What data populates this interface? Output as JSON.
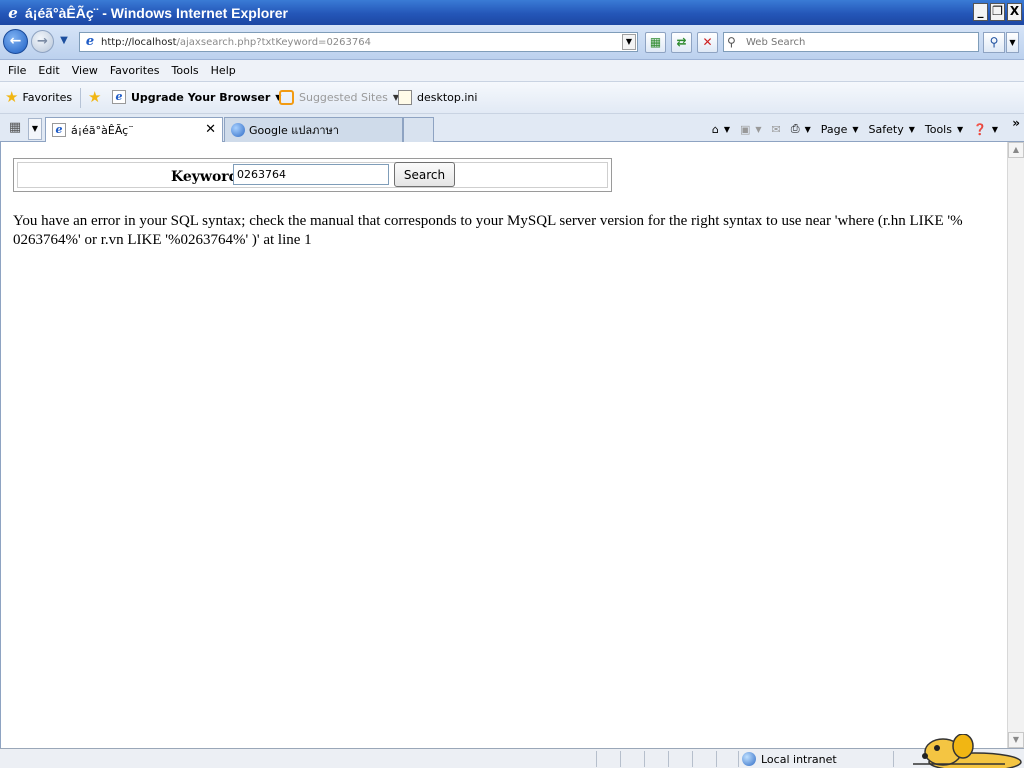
{
  "window": {
    "title": "á¡éã°àÊÃç¨ - Windows Internet Explorer",
    "controls": {
      "minimize": "_",
      "restore": "❐",
      "close": "X"
    }
  },
  "navigation": {
    "url_host": "http://localhost",
    "url_path": "/ajaxsearch.php?txtKeyword=0263764",
    "search_placeholder": "Web Search"
  },
  "menu": [
    "File",
    "Edit",
    "View",
    "Favorites",
    "Tools",
    "Help"
  ],
  "favorites_bar": {
    "favorites_label": "Favorites",
    "items": [
      "Upgrade Your Browser",
      "Suggested Sites",
      "desktop.ini"
    ]
  },
  "tabs": [
    {
      "label": "á¡éã°àÊÃç¨",
      "active": true
    },
    {
      "label": "Google แปลภาษา",
      "active": false
    }
  ],
  "command_bar": [
    "Page",
    "Safety",
    "Tools"
  ],
  "form": {
    "label": "Keyword",
    "value": "0263764",
    "button": "Search"
  },
  "error_message": "You have an error in your SQL syntax; check the manual that corresponds to your MySQL server version for the right syntax to use near 'where (r.hn LIKE '% 0263764%' or r.vn LIKE '%0263764%' )' at line 1",
  "statusbar": {
    "zone": "Local intranet"
  },
  "colors": {
    "titlebar": "#2456b8",
    "toolbar": "#d6e4f7",
    "content_bg": "#ffffff"
  }
}
